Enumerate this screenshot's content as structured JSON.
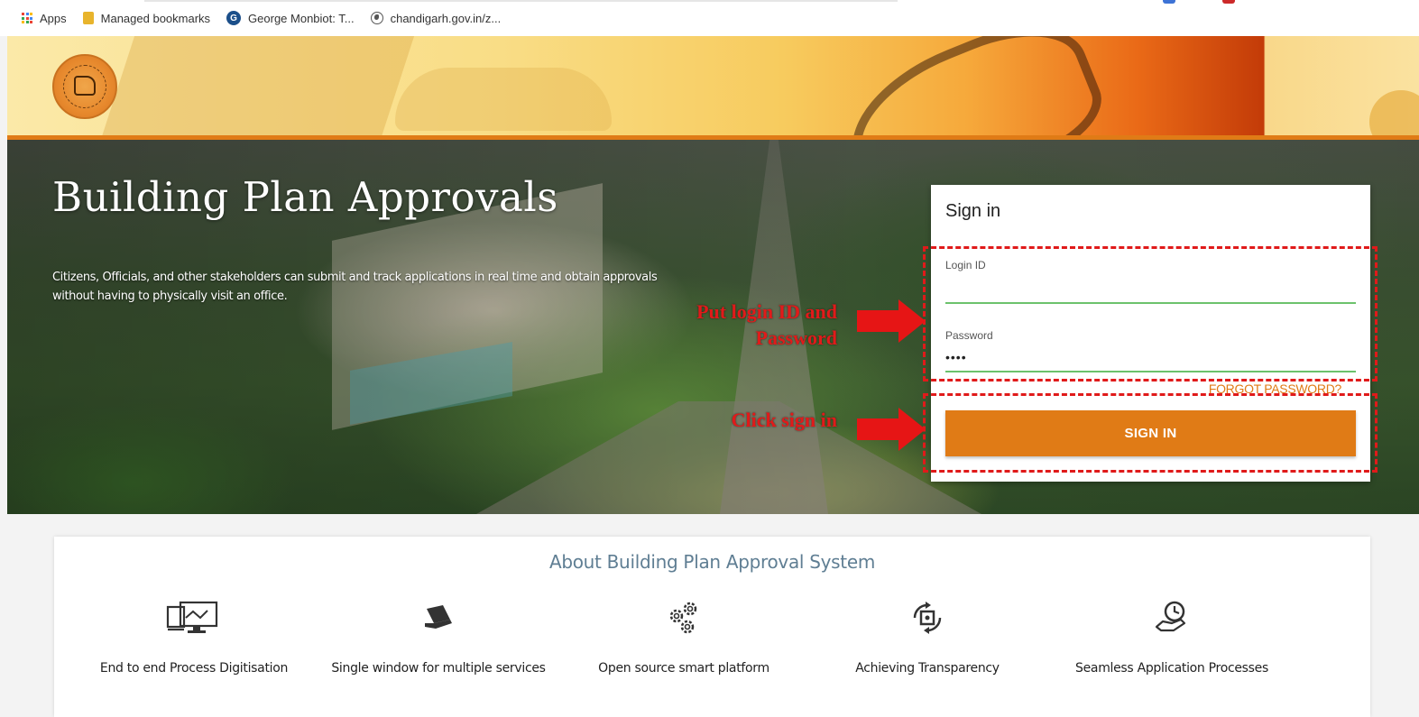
{
  "bookmarks": {
    "items": [
      {
        "label": "Apps",
        "icon": "apps-grid-icon"
      },
      {
        "label": "Managed bookmarks",
        "icon": "folder-icon"
      },
      {
        "label": "George Monbiot: T...",
        "icon": "site-favicon-icon"
      },
      {
        "label": "chandigarh.gov.in/z...",
        "icon": "globe-icon"
      }
    ],
    "apps_colors": [
      "#ea4335",
      "#4285f4",
      "#fbbc05",
      "#34a853",
      "#ea4335",
      "#4285f4",
      "#fbbc05",
      "#34a853",
      "#ea4335"
    ]
  },
  "banner": {
    "logo": "chandigarh-administration-emblem",
    "stripe_color": "#e07b16"
  },
  "hero": {
    "title": "Building Plan Approvals",
    "description": "Citizens, Officials, and other stakeholders can submit and track applications in real time and obtain approvals without having to physically visit an office."
  },
  "annotations": {
    "step1": "Put login ID and Password",
    "step2": "Click sign in",
    "color": "#e01a1a"
  },
  "signin": {
    "title": "Sign in",
    "login_label": "Login ID",
    "login_value": "",
    "password_label": "Password",
    "password_value": "••••",
    "forgot_label": "FORGOT PASSWORD?",
    "button_label": "SIGN IN",
    "accent_color": "#e07b16",
    "input_underline_color": "#6cc26c"
  },
  "about": {
    "title": "About Building Plan Approval System",
    "features": [
      {
        "label": "End to end Process Digitisation",
        "icon": "devices-sync-icon"
      },
      {
        "label": "Single window for multiple services",
        "icon": "laptop-icon"
      },
      {
        "label": "Open source smart platform",
        "icon": "gears-icon"
      },
      {
        "label": "Achieving Transparency",
        "icon": "transparency-exchange-icon"
      },
      {
        "label": "Seamless Application Processes",
        "icon": "hand-clock-icon"
      }
    ]
  }
}
